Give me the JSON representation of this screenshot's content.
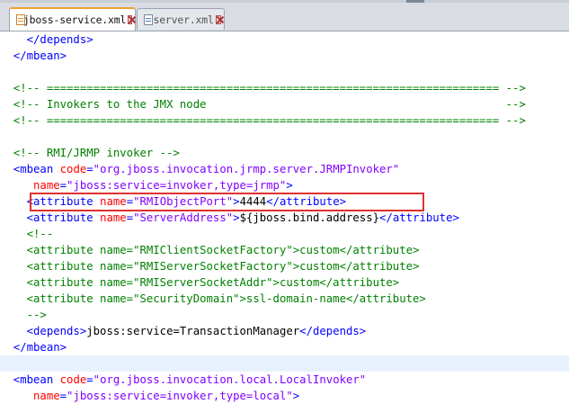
{
  "tabs": [
    {
      "label": "jboss-service.xml",
      "active": true
    },
    {
      "label": "server.xml",
      "active": false
    }
  ],
  "colors": {
    "tag": "#0000ff",
    "attr_name": "#ff0000",
    "attr_value": "#8000ff",
    "comment": "#008000",
    "highlight_box": "#e03030",
    "current_line": "#e8f2fe"
  },
  "editor": {
    "lines": [
      [
        {
          "k": "tag",
          "t": "    </depends>"
        }
      ],
      [
        {
          "k": "tag",
          "t": "  </mbean>"
        }
      ],
      [],
      [
        {
          "k": "cmt",
          "t": "  <!-- ==================================================================== -->"
        }
      ],
      [
        {
          "k": "cmt",
          "t": "  <!-- Invokers to the JMX node                                             -->"
        }
      ],
      [
        {
          "k": "cmt",
          "t": "  <!-- ==================================================================== -->"
        }
      ],
      [],
      [
        {
          "k": "cmt",
          "t": "  <!-- RMI/JRMP invoker -->"
        }
      ],
      [
        {
          "k": "tag",
          "t": "  <mbean "
        },
        {
          "k": "attr",
          "t": "code"
        },
        {
          "k": "tag",
          "t": "="
        },
        {
          "k": "val",
          "t": "\"org.jboss.invocation.jrmp.server.JRMPInvoker\""
        }
      ],
      [
        {
          "k": "attr",
          "t": "     name"
        },
        {
          "k": "tag",
          "t": "="
        },
        {
          "k": "val",
          "t": "\"jboss:service=invoker,type=jrmp\""
        },
        {
          "k": "tag",
          "t": ">"
        }
      ],
      [
        {
          "k": "tag",
          "t": "    <attribute "
        },
        {
          "k": "attr",
          "t": "name"
        },
        {
          "k": "tag",
          "t": "="
        },
        {
          "k": "val",
          "t": "\"RMIObjectPort\""
        },
        {
          "k": "tag",
          "t": ">"
        },
        {
          "k": "text",
          "t": "4444"
        },
        {
          "k": "tag",
          "t": "</attribute>"
        }
      ],
      [
        {
          "k": "tag",
          "t": "    <attribute "
        },
        {
          "k": "attr",
          "t": "name"
        },
        {
          "k": "tag",
          "t": "="
        },
        {
          "k": "val",
          "t": "\"ServerAddress\""
        },
        {
          "k": "tag",
          "t": ">"
        },
        {
          "k": "text",
          "t": "${jboss.bind.address}"
        },
        {
          "k": "tag",
          "t": "</attribute>"
        }
      ],
      [
        {
          "k": "cmt",
          "t": "    <!--"
        }
      ],
      [
        {
          "k": "cmt",
          "t": "    <attribute name=\"RMIClientSocketFactory\">custom</attribute>"
        }
      ],
      [
        {
          "k": "cmt",
          "t": "    <attribute name=\"RMIServerSocketFactory\">custom</attribute>"
        }
      ],
      [
        {
          "k": "cmt",
          "t": "    <attribute name=\"RMIServerSocketAddr\">custom</attribute>"
        }
      ],
      [
        {
          "k": "cmt",
          "t": "    <attribute name=\"SecurityDomain\">ssl-domain-name</attribute>"
        }
      ],
      [
        {
          "k": "cmt",
          "t": "    -->"
        }
      ],
      [
        {
          "k": "tag",
          "t": "    <depends>"
        },
        {
          "k": "text",
          "t": "jboss:service=TransactionManager"
        },
        {
          "k": "tag",
          "t": "</depends>"
        }
      ],
      [
        {
          "k": "tag",
          "t": "  </mbean>"
        }
      ],
      [],
      [
        {
          "k": "tag",
          "t": "  <mbean "
        },
        {
          "k": "attr",
          "t": "code"
        },
        {
          "k": "tag",
          "t": "="
        },
        {
          "k": "val",
          "t": "\"org.jboss.invocation.local.LocalInvoker\""
        }
      ],
      [
        {
          "k": "attr",
          "t": "     name"
        },
        {
          "k": "tag",
          "t": "="
        },
        {
          "k": "val",
          "t": "\"jboss:service=invoker,type=local\""
        },
        {
          "k": "tag",
          "t": ">"
        }
      ]
    ]
  }
}
